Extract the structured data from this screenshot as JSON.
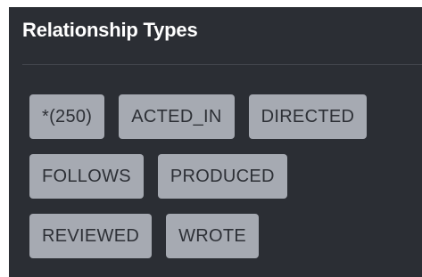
{
  "panel": {
    "title": "Relationship Types",
    "tags": [
      [
        "*(250)",
        "ACTED_IN",
        "DIRECTED"
      ],
      [
        "FOLLOWS",
        "PRODUCED"
      ],
      [
        "REVIEWED",
        "WROTE"
      ]
    ]
  },
  "colors": {
    "panel_background": "#2b2e34",
    "tag_background": "#a6aab2",
    "tag_text": "#2d3036",
    "title_text": "#ffffff"
  }
}
